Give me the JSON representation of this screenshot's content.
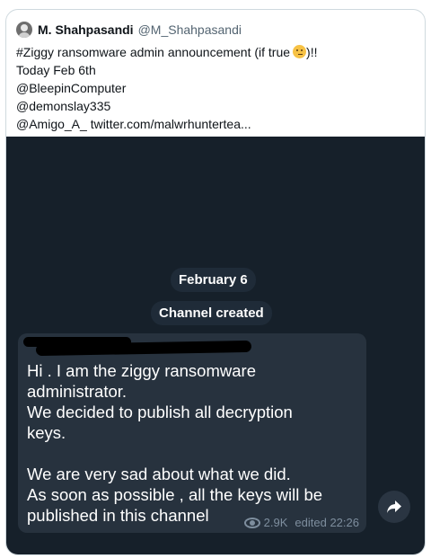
{
  "tweet": {
    "author_name": "M. Shahpasandi",
    "author_handle": "@M_Shahpasandi",
    "lines": [
      "#Ziggy ransomware admin announcement (if true",
      "Today Feb 6th",
      "@BleepinComputer",
      "@demonslay335",
      "@Amigo_A_ twitter.com/malwrhuntertea..."
    ],
    "line1_suffix": ")!!",
    "emoji": "thinking-face-icon"
  },
  "telegram": {
    "date_pill": "February 6",
    "service_pill": "Channel created",
    "message_lines": [
      "Hi . I am the ziggy ransomware",
      "administrator.",
      "We decided to publish all decryption",
      "keys.",
      "",
      "We are very sad about what we did.",
      "As soon as possible , all the keys will be",
      "published in this channel"
    ],
    "views": "2.9K",
    "edited": "edited 22:26"
  },
  "colors": {
    "background_dark": "#16202a",
    "bubble": "#27323e",
    "meta_text": "#7e8e9e"
  }
}
